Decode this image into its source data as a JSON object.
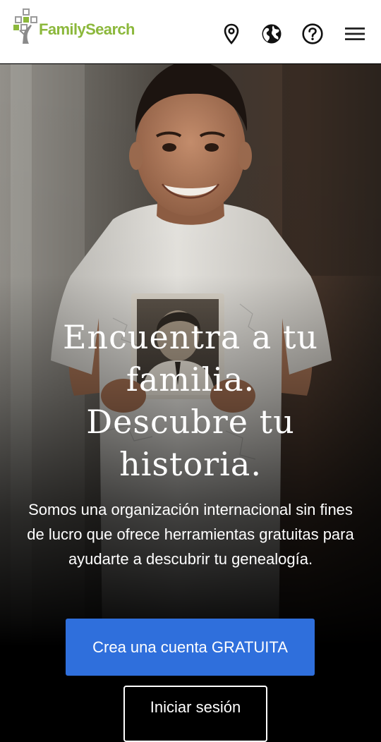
{
  "header": {
    "brand": "FamilySearch",
    "brand_color": "#8cb83c",
    "icons": [
      "location-pin-icon",
      "globe-icon",
      "help-icon",
      "hamburger-menu-icon"
    ]
  },
  "hero": {
    "headline_lines": [
      "Encuentra a tu",
      "familia.",
      "Descubre tu",
      "historia."
    ],
    "description": "Somos una organización internacional sin fines de lucro que ofrece herramientas gratuitas para ayudarte a descubrir tu genealogía.",
    "image": "smiling-boy-holding-vintage-photograph"
  },
  "actions": {
    "create_account_label": "Crea una cuenta GRATUITA",
    "sign_in_label": "Iniciar sesión",
    "primary_color": "#2f6fdc"
  }
}
